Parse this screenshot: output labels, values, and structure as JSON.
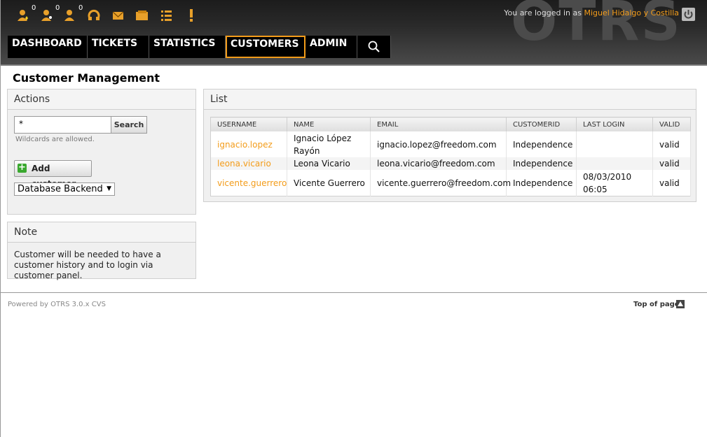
{
  "header": {
    "logo_text": "OTRS",
    "login_prefix": "You are logged in as",
    "user_name": "Miguel Hidalgo y Costilla",
    "toolbar": [
      {
        "icon": "locked-tickets-new-icon",
        "count": "0"
      },
      {
        "icon": "watched-tickets-icon",
        "count": "0"
      },
      {
        "icon": "responsible-tickets-icon",
        "count": "0"
      },
      {
        "icon": "phone-ticket-icon"
      },
      {
        "icon": "email-ticket-icon"
      },
      {
        "icon": "search-ticket-folder-icon"
      },
      {
        "icon": "queue-view-icon"
      },
      {
        "icon": "escalation-view-icon"
      }
    ],
    "nav": [
      {
        "label": "DASHBOARD"
      },
      {
        "label": "TICKETS"
      },
      {
        "label": "STATISTICS"
      },
      {
        "label": "CUSTOMERS",
        "selected": true
      },
      {
        "label": "ADMIN"
      }
    ],
    "accent_color": "#f39c1a"
  },
  "page": {
    "title": "Customer Management"
  },
  "actions": {
    "heading": "Actions",
    "search_value": "*",
    "search_button": "Search",
    "wildcards_hint": "Wildcards are allowed.",
    "add_button": "Add customer",
    "backend_selected": "Database Backend"
  },
  "note": {
    "heading": "Note",
    "text": "Customer will be needed to have a customer history and to login via customer panel."
  },
  "list": {
    "heading": "List",
    "columns": [
      "USERNAME",
      "NAME",
      "EMAIL",
      "CUSTOMERID",
      "LAST LOGIN",
      "VALID"
    ],
    "rows": [
      {
        "username": "ignacio.lopez",
        "name": "Ignacio López Rayón",
        "email": "ignacio.lopez@freedom.com",
        "customerid": "Independence",
        "last_login": "",
        "valid": "valid"
      },
      {
        "username": "leona.vicario",
        "name": "Leona Vicario",
        "email": "leona.vicario@freedom.com",
        "customerid": "Independence",
        "last_login": "",
        "valid": "valid"
      },
      {
        "username": "vicente.guerrero",
        "name": "Vicente Guerrero",
        "email": "vicente.guerrero@freedom.com",
        "customerid": "Independence",
        "last_login": "08/03/2010 06:05",
        "valid": "valid"
      }
    ]
  },
  "footer": {
    "powered_by": "Powered by OTRS 3.0.x CVS",
    "top_of_page": "Top of page"
  }
}
